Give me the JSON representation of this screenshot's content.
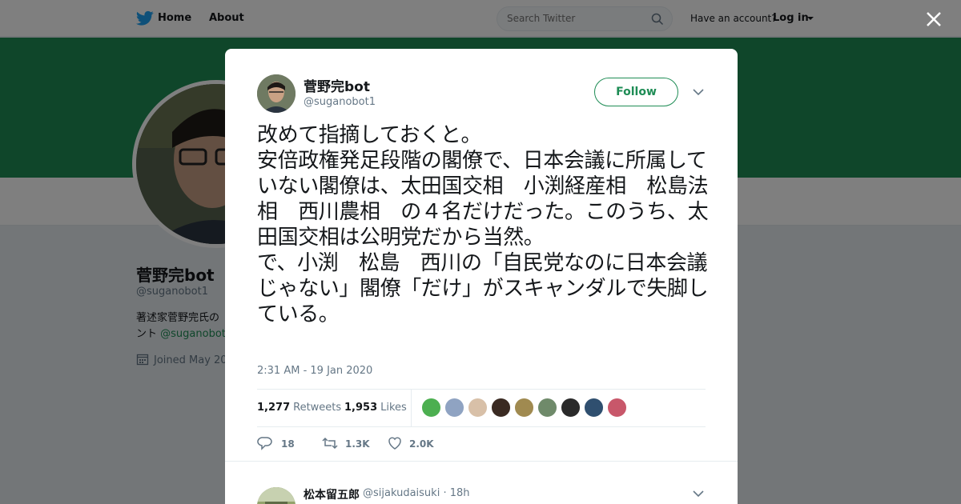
{
  "nav": {
    "home_label": "Home",
    "about_label": "About",
    "search_placeholder": "Search Twitter",
    "have_account": "Have an account?",
    "login_label": "Log in"
  },
  "profile": {
    "name": "菅野完bot",
    "handle": "@suganobot1",
    "bio_text": "著述家菅野完氏の",
    "bio_suffix": "ント",
    "bio_link": "@suganobot",
    "joined": "Joined May 20"
  },
  "tweet": {
    "author_name": "菅野完bot",
    "author_handle": "@suganobot1",
    "follow_label": "Follow",
    "text": "改めて指摘しておくと。\n安倍政権発足段階の閣僚で、日本会議に所属していない閣僚は、太田国交相　小渕経産相　松島法相　西川農相　の４名だけだった。このうち、太田国交相は公明党だから当然。\nで、小渕　松島　西川の「自民党なのに日本会議じゃない」閣僚「だけ」がスキャンダルで失脚している。",
    "timestamp": "2:31 AM - 19 Jan 2020",
    "retweets_count": "1,277",
    "retweets_label": "Retweets",
    "likes_count": "1,953",
    "likes_label": "Likes",
    "reply_count": "18",
    "retweet_action_count": "1.3K",
    "like_action_count": "2.0K"
  },
  "likers": [
    {
      "color": "#4caf50",
      "icon": "avatar"
    },
    {
      "color": "#8fa3c2",
      "icon": "avatar"
    },
    {
      "color": "#d8c0a8",
      "icon": "avatar"
    },
    {
      "color": "#3a2a22",
      "icon": "avatar"
    },
    {
      "color": "#a08a50",
      "icon": "avatar"
    },
    {
      "color": "#6f8a6a",
      "icon": "avatar"
    },
    {
      "color": "#2a2a2a",
      "icon": "avatar"
    },
    {
      "color": "#2f4f6f",
      "icon": "avatar"
    },
    {
      "color": "#c8576a",
      "icon": "avatar"
    }
  ],
  "reply": {
    "name": "松本留五郎",
    "handle": "@sijakudaisuki · 18h"
  },
  "colors": {
    "brand": "#1e8c55",
    "twitter_blue": "#1da1f2",
    "text": "#14171a",
    "muted": "#657786"
  }
}
